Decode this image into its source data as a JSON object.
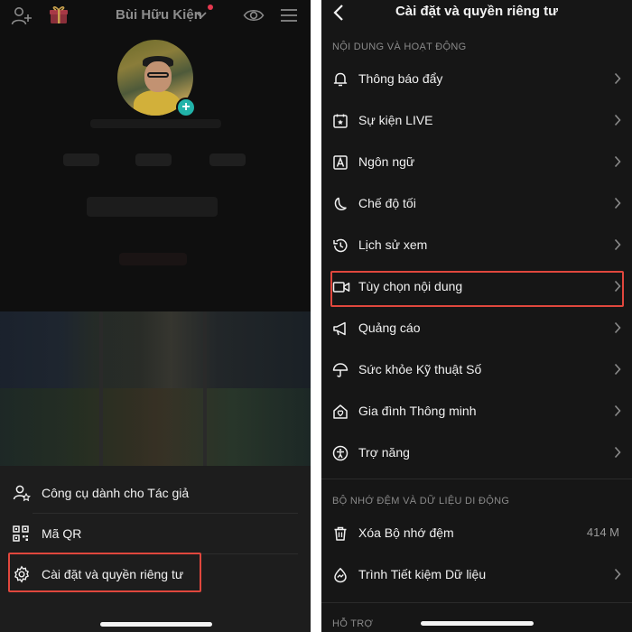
{
  "left": {
    "username": "Bùi Hữu Kiện",
    "sheet": {
      "items": [
        {
          "label": "Công cụ dành cho Tác giả",
          "icon": "creator-tools-icon"
        },
        {
          "label": "Mã QR",
          "icon": "qr-code-icon"
        },
        {
          "label": "Cài đặt và quyền riêng tư",
          "icon": "settings-gear-icon"
        }
      ]
    }
  },
  "right": {
    "title": "Cài đặt và quyền riêng tư",
    "sections": [
      {
        "heading": "NỘI DUNG VÀ HOẠT ĐỘNG",
        "items": [
          {
            "label": "Thông báo đẩy",
            "icon": "bell-icon"
          },
          {
            "label": "Sự kiện LIVE",
            "icon": "calendar-star-icon"
          },
          {
            "label": "Ngôn ngữ",
            "icon": "language-a-icon"
          },
          {
            "label": "Chế độ tối",
            "icon": "moon-icon"
          },
          {
            "label": "Lịch sử xem",
            "icon": "history-clock-icon"
          },
          {
            "label": "Tùy chọn nội dung",
            "icon": "video-camera-icon"
          },
          {
            "label": "Quảng cáo",
            "icon": "megaphone-icon"
          },
          {
            "label": "Sức khỏe Kỹ thuật Số",
            "icon": "umbrella-icon"
          },
          {
            "label": "Gia đình Thông minh",
            "icon": "family-home-icon"
          },
          {
            "label": "Trợ năng",
            "icon": "accessibility-icon"
          }
        ]
      },
      {
        "heading": "BỘ NHỚ ĐỆM VÀ DỮ LIỆU DI ĐỘNG",
        "items": [
          {
            "label": "Xóa Bộ nhớ đệm",
            "icon": "trash-icon",
            "value": "414 M"
          },
          {
            "label": "Trình Tiết kiệm Dữ liệu",
            "icon": "data-saver-icon"
          }
        ]
      },
      {
        "heading": "HỖ TRỢ",
        "items": []
      }
    ]
  },
  "colors": {
    "highlight": "#e0473d",
    "background": "#161616",
    "text": "#f0f0f0",
    "section": "#8a8a8a"
  }
}
